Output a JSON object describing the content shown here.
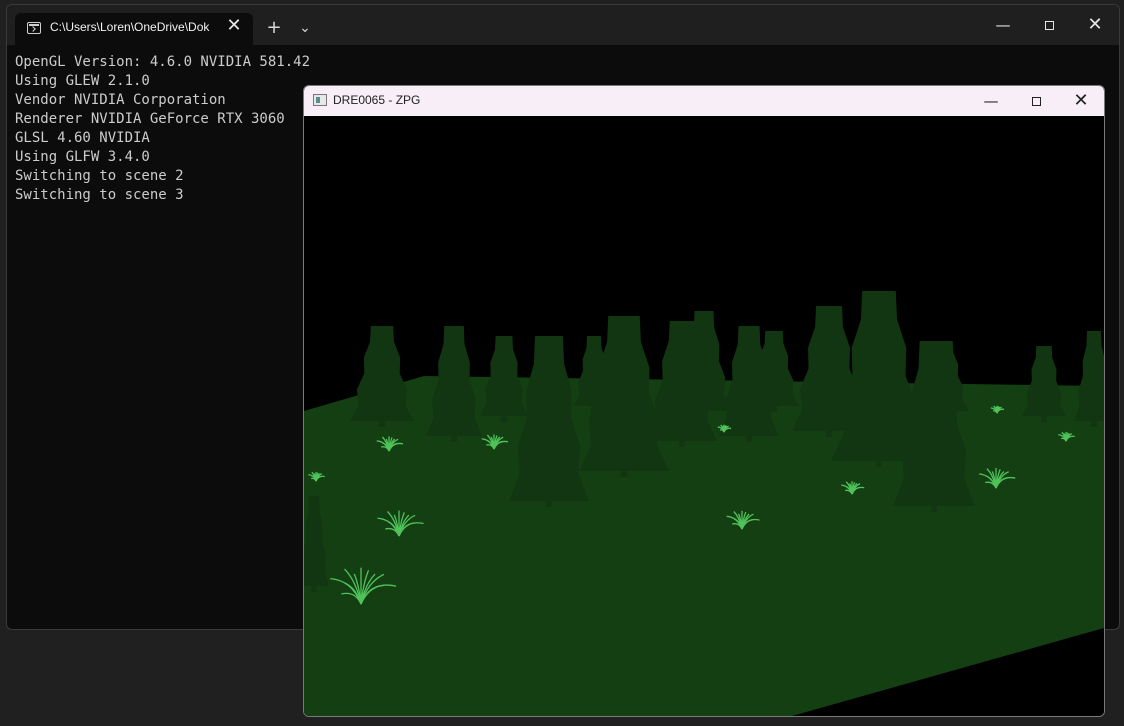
{
  "terminal": {
    "tab_title": "C:\\Users\\Loren\\OneDrive\\Dok",
    "tab_close_glyph": "✕",
    "new_tab_glyph": "+",
    "dropdown_glyph": "⌄",
    "minimize_glyph": "—",
    "close_glyph": "✕",
    "output_lines": [
      "OpenGL Version: 4.6.0 NVIDIA 581.42",
      "Using GLEW 2.1.0",
      "Vendor NVIDIA Corporation",
      "Renderer NVIDIA GeForce RTX 3060",
      "GLSL 4.60 NVIDIA",
      "Using GLFW 3.4.0",
      "Switching to scene 2",
      "Switching to scene 3"
    ]
  },
  "gl_window": {
    "title": "DRE0065 - ZPG",
    "minimize_glyph": "—",
    "close_glyph": "✕"
  },
  "scene": {
    "sky_color": "#000000",
    "ground_color": "#143f13",
    "tree_color": "#123612",
    "grass_color": "#4fc35a",
    "icons": [
      "console-icon",
      "app-window-icon"
    ]
  }
}
